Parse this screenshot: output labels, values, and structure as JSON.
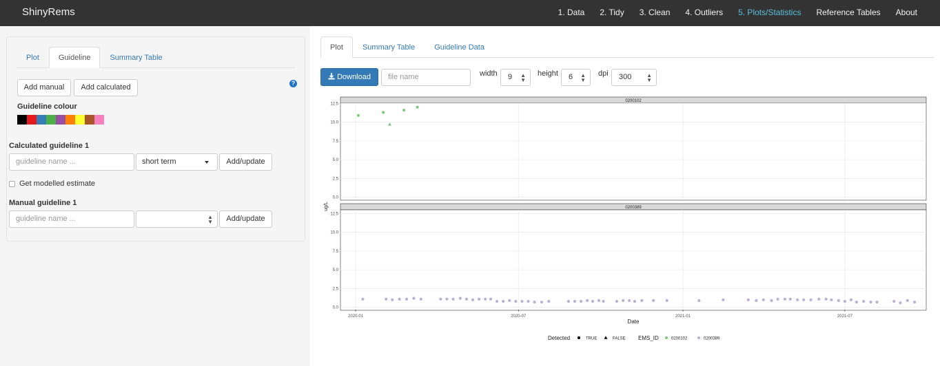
{
  "app": {
    "title": "ShinyRems",
    "nav": [
      "1. Data",
      "2. Tidy",
      "3. Clean",
      "4. Outliers",
      "5. Plots/Statistics",
      "Reference Tables",
      "About"
    ],
    "active_nav": "5. Plots/Statistics"
  },
  "sidebar": {
    "tabs": [
      "Plot",
      "Guideline",
      "Summary Table"
    ],
    "active_tab": "Guideline",
    "add_manual_label": "Add manual",
    "add_calculated_label": "Add calculated",
    "help_icon": "?",
    "guideline_colour_label": "Guideline colour",
    "colours": [
      "#000000",
      "#e41a1c",
      "#377eb8",
      "#4daf4a",
      "#984ea3",
      "#ff7f00",
      "#ffff33",
      "#a65628",
      "#f781bf"
    ],
    "calculated_title": "Calculated guideline 1",
    "calc_name_placeholder": "guideline name ...",
    "calc_term_value": "short term",
    "add_update_label": "Add/update",
    "modelled_label": "Get modelled estimate",
    "manual_title": "Manual guideline 1",
    "manual_name_placeholder": "guideline name ...",
    "manual_add_update_label": "Add/update"
  },
  "main": {
    "tabs": [
      "Plot",
      "Summary Table",
      "Guideline Data"
    ],
    "active_tab": "Plot",
    "download_label": "Download",
    "download_icon": "download-icon",
    "file_placeholder": "file name",
    "width_label": "width",
    "width_value": "9",
    "height_label": "height",
    "height_value": "6",
    "dpi_label": "dpi",
    "dpi_value": "300"
  },
  "chart_data": {
    "type": "scatter",
    "ylabel": "ug/L",
    "xlabel": "Date",
    "x_ticks": [
      "2020-01",
      "2020-07",
      "2021-01",
      "2021-07"
    ],
    "x_range": [
      "2019-12-15",
      "2021-09-30"
    ],
    "y_ticks": [
      "0.0",
      "2.5",
      "5.0",
      "7.5",
      "10.0",
      "12.5"
    ],
    "ylim": [
      -0.3,
      12.8
    ],
    "grid": true,
    "panels": [
      {
        "strip": "0200102",
        "series": [
          {
            "name": "0200102",
            "color": "#7fc97f",
            "shape": "circle",
            "detected": "TRUE",
            "points": [
              [
                "2020-01-04",
                10.9
              ],
              [
                "2020-02-01",
                11.3
              ],
              [
                "2020-02-24",
                11.6
              ],
              [
                "2020-03-10",
                12.0
              ]
            ]
          },
          {
            "name": "0200102",
            "color": "#7fc97f",
            "shape": "triangle",
            "detected": "FALSE",
            "points": [
              [
                "2020-02-08",
                9.7
              ]
            ]
          }
        ]
      },
      {
        "strip": "0200389",
        "series": [
          {
            "name": "0200389",
            "color": "#beaed4",
            "shape": "circle",
            "detected": "TRUE",
            "points": [
              [
                "2020-01-09",
                1.1
              ],
              [
                "2020-02-04",
                1.1
              ],
              [
                "2020-02-11",
                1.0
              ],
              [
                "2020-02-19",
                1.1
              ],
              [
                "2020-02-27",
                1.1
              ],
              [
                "2020-03-06",
                1.2
              ],
              [
                "2020-03-14",
                1.1
              ],
              [
                "2020-04-05",
                1.1
              ],
              [
                "2020-04-12",
                1.1
              ],
              [
                "2020-04-19",
                1.1
              ],
              [
                "2020-04-27",
                1.2
              ],
              [
                "2020-05-04",
                1.1
              ],
              [
                "2020-05-11",
                1.0
              ],
              [
                "2020-05-18",
                1.1
              ],
              [
                "2020-05-25",
                1.1
              ],
              [
                "2020-05-31",
                1.1
              ],
              [
                "2020-06-07",
                0.8
              ],
              [
                "2020-06-14",
                0.8
              ],
              [
                "2020-06-21",
                0.9
              ],
              [
                "2020-06-28",
                0.8
              ],
              [
                "2020-07-05",
                0.8
              ],
              [
                "2020-07-12",
                0.8
              ],
              [
                "2020-07-19",
                0.7
              ],
              [
                "2020-07-27",
                0.7
              ],
              [
                "2020-08-04",
                0.8
              ],
              [
                "2020-08-26",
                0.8
              ],
              [
                "2020-09-02",
                0.8
              ],
              [
                "2020-09-09",
                0.8
              ],
              [
                "2020-09-16",
                0.9
              ],
              [
                "2020-09-22",
                0.8
              ],
              [
                "2020-09-29",
                0.9
              ],
              [
                "2020-10-04",
                0.8
              ],
              [
                "2020-10-19",
                0.8
              ],
              [
                "2020-10-26",
                0.9
              ],
              [
                "2020-11-02",
                0.9
              ],
              [
                "2020-11-08",
                0.8
              ],
              [
                "2020-11-16",
                0.9
              ],
              [
                "2020-11-29",
                0.9
              ],
              [
                "2020-12-14",
                0.9
              ],
              [
                "2021-01-19",
                0.9
              ],
              [
                "2021-02-15",
                1.0
              ],
              [
                "2021-03-15",
                1.0
              ],
              [
                "2021-03-24",
                0.9
              ],
              [
                "2021-04-01",
                1.0
              ],
              [
                "2021-04-10",
                0.9
              ],
              [
                "2021-04-17",
                1.1
              ],
              [
                "2021-04-25",
                1.1
              ],
              [
                "2021-05-01",
                1.1
              ],
              [
                "2021-05-09",
                1.0
              ],
              [
                "2021-05-16",
                1.0
              ],
              [
                "2021-05-24",
                1.0
              ],
              [
                "2021-06-02",
                1.1
              ],
              [
                "2021-06-10",
                1.1
              ],
              [
                "2021-06-16",
                1.0
              ],
              [
                "2021-06-24",
                0.9
              ],
              [
                "2021-07-01",
                0.8
              ],
              [
                "2021-07-08",
                1.0
              ],
              [
                "2021-07-14",
                0.7
              ],
              [
                "2021-07-22",
                0.8
              ],
              [
                "2021-07-30",
                0.7
              ],
              [
                "2021-08-06",
                0.7
              ],
              [
                "2021-08-25",
                0.8
              ],
              [
                "2021-09-01",
                0.6
              ],
              [
                "2021-09-09",
                0.9
              ],
              [
                "2021-09-17",
                0.7
              ]
            ]
          }
        ]
      }
    ],
    "legend": {
      "placement": "bottom",
      "detected_title": "Detected",
      "detected_items": [
        "TRUE",
        "FALSE"
      ],
      "ems_title": "EMS_ID",
      "ems_items": [
        "0200102",
        "0200389"
      ],
      "ems_colors": [
        "#7fc97f",
        "#beaed4"
      ]
    }
  }
}
